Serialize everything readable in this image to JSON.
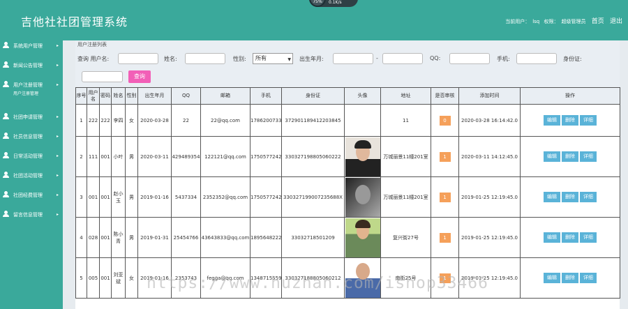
{
  "header": {
    "title": "吉他社社团管理系统",
    "current_user_label": "当前用户：",
    "current_user": "lsq",
    "role_label": "权限：",
    "role": "超级管理员",
    "home_link": "首页",
    "logout_link": "退出"
  },
  "speed_widget": {
    "percent": "75%",
    "value": "0.1K/s"
  },
  "sidebar": {
    "items": [
      {
        "label": "系统用户管理",
        "open": false
      },
      {
        "label": "新闻公告管理",
        "open": false
      },
      {
        "label": "用户注册管理",
        "open": true,
        "sub": "用户注册管理"
      },
      {
        "label": "社团申请管理",
        "open": false
      },
      {
        "label": "社员信息管理",
        "open": false
      },
      {
        "label": "日常活动管理",
        "open": false
      },
      {
        "label": "社团活动管理",
        "open": false
      },
      {
        "label": "社团经费管理",
        "open": false
      },
      {
        "label": "留言信息管理",
        "open": false
      }
    ]
  },
  "breadcrumb": "用户注册列表",
  "search": {
    "username_label": "查询 用户名:",
    "name_label": "姓名:",
    "gender_label": "性别:",
    "gender_value": "所有",
    "birth_label": "出生年月:",
    "range_sep": "-",
    "qq_label": "QQ:",
    "phone_label": "手机:",
    "idcard_label": "身份证:",
    "query_button": "查询"
  },
  "table": {
    "columns": [
      "序号",
      "用户名",
      "密码",
      "姓名",
      "性别",
      "出生年月",
      "QQ",
      "邮箱",
      "手机",
      "身份证",
      "头像",
      "地址",
      "是否审核",
      "添加时间",
      "操作"
    ],
    "rows": [
      {
        "no": "1",
        "username": "222",
        "password": "222",
        "name": "李四",
        "gender": "女",
        "birth": "2020-03-28",
        "qq": "22",
        "email": "22@qq.com",
        "phone": "17862007337",
        "idcard": "372901189412203845",
        "avatar": "",
        "address": "11",
        "audit": "0",
        "added": "2020-03-28 16:14:42.0"
      },
      {
        "no": "2",
        "username": "111",
        "password": "001",
        "name": "小叶",
        "gender": "男",
        "birth": "2020-03-11",
        "qq": "429489354",
        "email": "122121@qq.com",
        "phone": "17505772420",
        "idcard": "330327198805060222",
        "avatar": "a",
        "address": "万城丽景11幢201室",
        "audit": "1",
        "added": "2020-03-11 14:12:45.0"
      },
      {
        "no": "3",
        "username": "001",
        "password": "001",
        "name": "赵小玉",
        "gender": "男",
        "birth": "2019-01-16",
        "qq": "5437334",
        "email": "2352352@qq.com",
        "phone": "17505772420",
        "idcard": "330327199007235688X",
        "avatar": "b",
        "address": "万城丽景11幢201室",
        "audit": "1",
        "added": "2019-01-25 12:19:45.0"
      },
      {
        "no": "4",
        "username": "028",
        "password": "001",
        "name": "陈小青",
        "gender": "男",
        "birth": "2019-01-31",
        "qq": "25454766",
        "email": "43643833@qq.com",
        "phone": "18956482221",
        "idcard": "33032718501209",
        "avatar": "c",
        "address": "复兴街27号",
        "audit": "1",
        "added": "2019-01-25 12:19:45.0"
      },
      {
        "no": "5",
        "username": "005",
        "password": "001",
        "name": "刘亚斌",
        "gender": "女",
        "birth": "2019-01-16",
        "qq": "2353743",
        "email": "fegga@qq.com",
        "phone": "13487155590",
        "idcard": "330327188805060212",
        "avatar": "d",
        "address": "南街25号",
        "audit": "1",
        "added": "2019-01-25 12:19:45.0"
      }
    ],
    "actions": {
      "edit": "编辑",
      "delete": "删除",
      "detail": "详细"
    }
  },
  "watermark": "https://www.huzhan.com/ishop33466"
}
